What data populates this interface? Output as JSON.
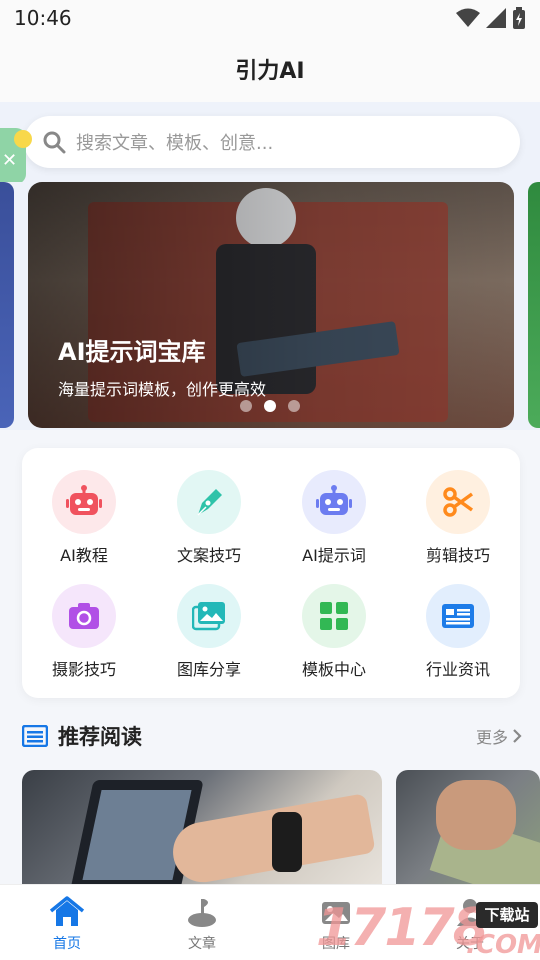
{
  "status_bar": {
    "time": "10:46"
  },
  "app_bar": {
    "title": "引力AI"
  },
  "search": {
    "placeholder": "搜索文章、模板、创意..."
  },
  "banner": {
    "title": "AI提示词宝库",
    "subtitle": "海量提示词模板，创作更高效",
    "page_indicator": {
      "count": 3,
      "active": 2
    }
  },
  "categories": [
    {
      "label": "AI教程",
      "icon": "robot-icon",
      "bg": "#fde8ea",
      "color": "#f0525e"
    },
    {
      "label": "文案技巧",
      "icon": "pen-icon",
      "bg": "#e2f7f4",
      "color": "#2fc3a9"
    },
    {
      "label": "AI提示词",
      "icon": "robot-icon",
      "bg": "#e8ebfd",
      "color": "#6c7cf0"
    },
    {
      "label": "剪辑技巧",
      "icon": "scissors-icon",
      "bg": "#fff0e0",
      "color": "#ff8a1c"
    },
    {
      "label": "摄影技巧",
      "icon": "camera-icon",
      "bg": "#f5e6fb",
      "color": "#b150e6"
    },
    {
      "label": "图库分享",
      "icon": "image-gallery-icon",
      "bg": "#dff6f6",
      "color": "#23b8b8"
    },
    {
      "label": "模板中心",
      "icon": "grid-icon",
      "bg": "#e4f6e8",
      "color": "#32b854"
    },
    {
      "label": "行业资讯",
      "icon": "news-icon",
      "bg": "#e2eefd",
      "color": "#1e7ce8"
    }
  ],
  "recommend": {
    "title": "推荐阅读",
    "more": "更多"
  },
  "bottom_nav": [
    {
      "label": "首页",
      "icon": "home-icon",
      "active": true
    },
    {
      "label": "文章",
      "icon": "article-icon",
      "active": false
    },
    {
      "label": "图库",
      "icon": "gallery-icon",
      "active": false
    },
    {
      "label": "关于",
      "icon": "user-icon",
      "active": false
    }
  ],
  "watermark": {
    "digits": "17178",
    "tag": "下载站",
    "com": ".COM"
  },
  "colors": {
    "accent": "#1677e6",
    "background": "#f4f6fa"
  }
}
